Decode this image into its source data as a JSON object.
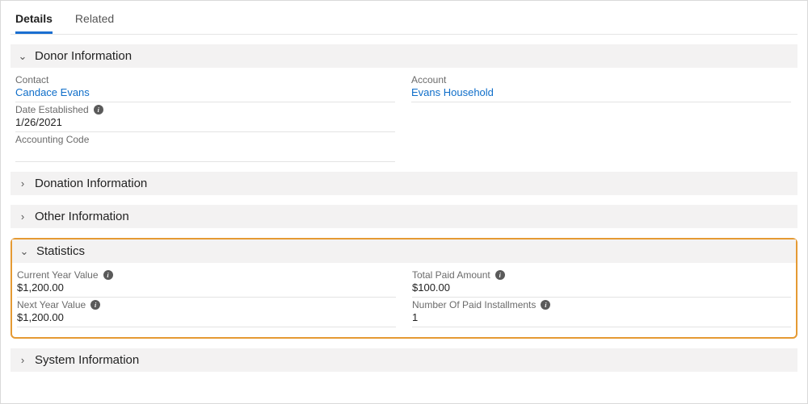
{
  "tabs": {
    "details": "Details",
    "related": "Related"
  },
  "sections": {
    "donor_info": {
      "title": "Donor Information",
      "contact_label": "Contact",
      "contact_value": "Candace Evans",
      "account_label": "Account",
      "account_value": "Evans Household",
      "date_established_label": "Date Established",
      "date_established_value": "1/26/2021",
      "accounting_code_label": "Accounting Code",
      "accounting_code_value": ""
    },
    "donation_info": {
      "title": "Donation Information"
    },
    "other_info": {
      "title": "Other Information"
    },
    "statistics": {
      "title": "Statistics",
      "current_year_label": "Current Year Value",
      "current_year_value": "$1,200.00",
      "total_paid_label": "Total Paid Amount",
      "total_paid_value": "$100.00",
      "next_year_label": "Next Year Value",
      "next_year_value": "$1,200.00",
      "num_installments_label": "Number Of Paid Installments",
      "num_installments_value": "1"
    },
    "system_info": {
      "title": "System Information"
    }
  }
}
